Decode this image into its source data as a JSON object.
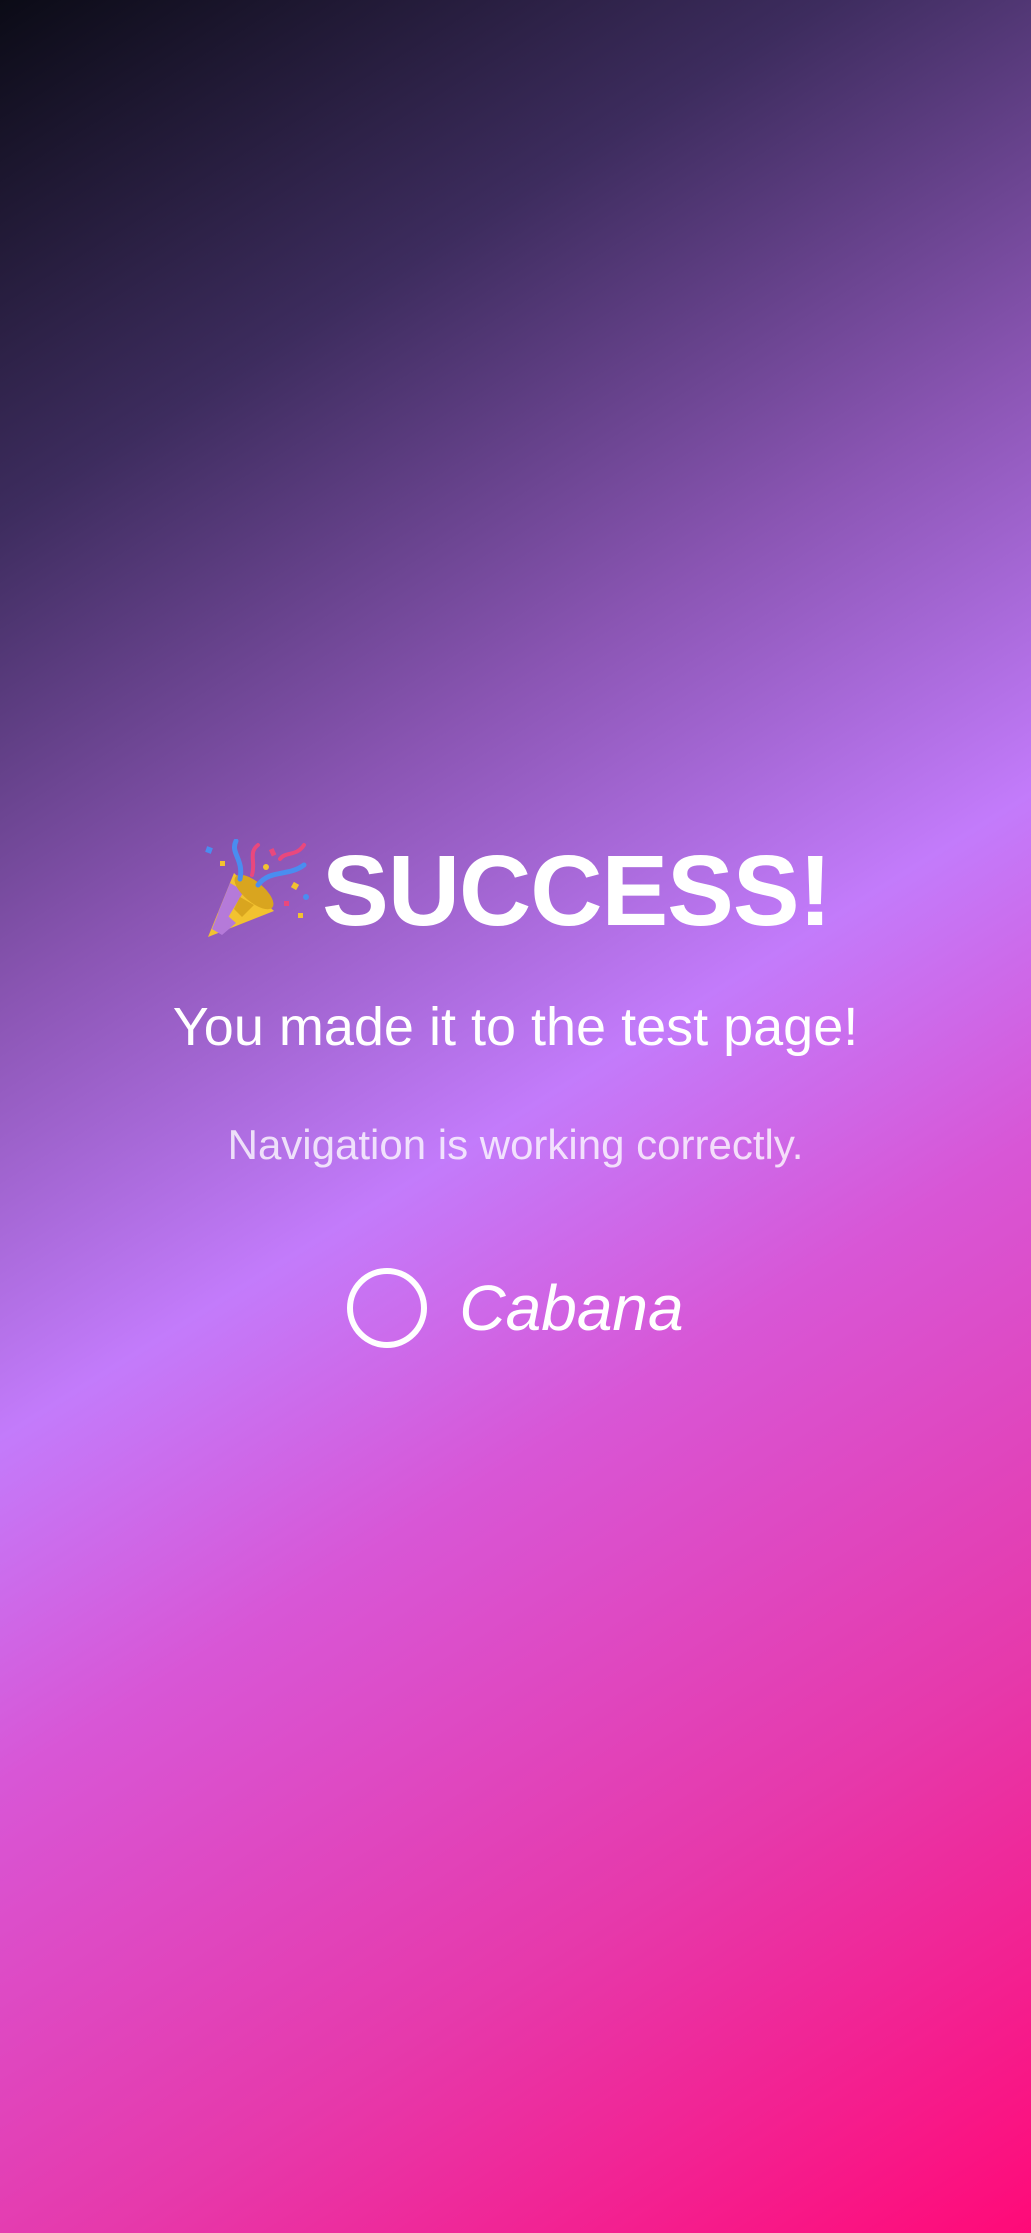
{
  "success_screen": {
    "icon": "party-popper-icon",
    "headline": "SUCCESS!",
    "subtitle": "You made it to the test page!",
    "caption": "Navigation is working correctly."
  },
  "brand": {
    "logo_icon": "ring-logo-icon",
    "name": "Cabana"
  },
  "colors": {
    "gradient_start": "#0b0b16",
    "gradient_mid": "#c37bfb",
    "gradient_end": "#ff0a78",
    "text": "#ffffff"
  }
}
